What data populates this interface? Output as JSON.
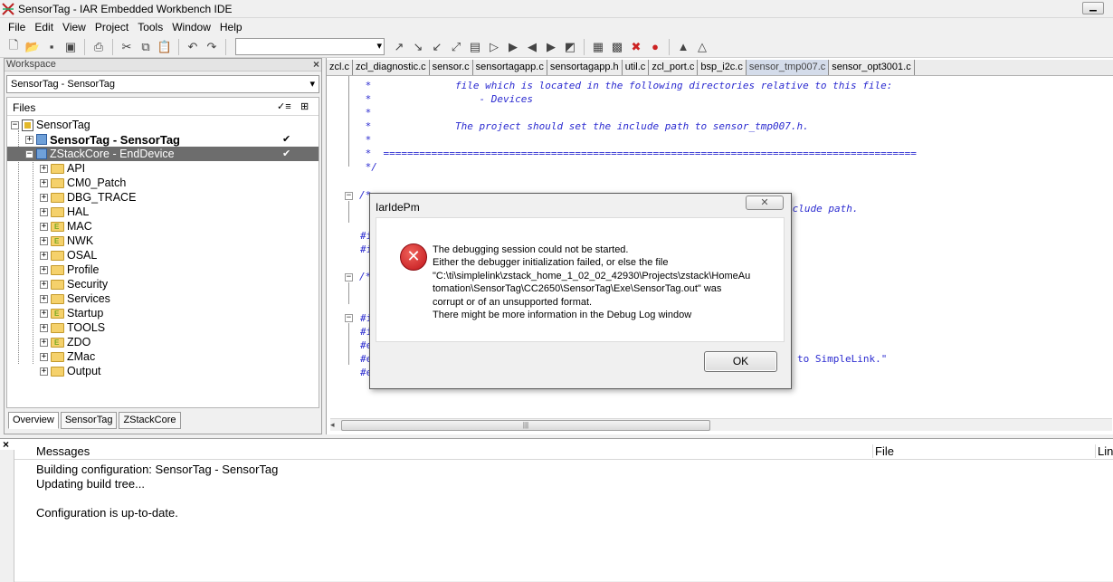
{
  "window": {
    "title": "SensorTag - IAR Embedded Workbench IDE"
  },
  "menu": [
    "File",
    "Edit",
    "View",
    "Project",
    "Tools",
    "Window",
    "Help"
  ],
  "workspace": {
    "header": "Workspace",
    "selected_config": "SensorTag - SensorTag",
    "files_header": "Files",
    "tree": {
      "root": "SensorTag",
      "project1": "SensorTag - SensorTag",
      "project2": "ZStackCore - EndDevice",
      "folders": [
        "API",
        "CM0_Patch",
        "DBG_TRACE",
        "HAL",
        "MAC",
        "NWK",
        "OSAL",
        "Profile",
        "Security",
        "Services",
        "Startup",
        "TOOLS",
        "ZDO",
        "ZMac",
        "Output"
      ]
    },
    "tabs": [
      "Overview",
      "SensorTag",
      "ZStackCore"
    ]
  },
  "editor": {
    "tabs": [
      "zcl.c",
      "zcl_diagnostic.c",
      "sensor.c",
      "sensortagapp.c",
      "sensortagapp.h",
      "util.c",
      "zcl_port.c",
      "bsp_i2c.c",
      "sensor_tmp007.c",
      "sensor_opt3001.c"
    ],
    "active_tab": "sensor_tmp007.c",
    "code": {
      "l1": " *              file which is located in the following directories relative to this file:",
      "l2": " *                  - Devices",
      "l3": " *",
      "l4": " *              The project should set the include path to sensor_tmp007.h.",
      "l5": " *",
      "l6": " *  =========================================================================================",
      "l7": " */",
      "l8": "/*",
      "l9": "nclude path.",
      "l10": "#i",
      "l11": "#i",
      "l12": "/*",
      "l13": "#i",
      "l14": "#i",
      "l15": "#e",
      "l16": "#e",
      "l17": "#e",
      "l18": "to SimpleLink.\""
    }
  },
  "messages": {
    "col_messages": "Messages",
    "col_file": "File",
    "col_line": "Lin",
    "lines": [
      "Building configuration: SensorTag - SensorTag",
      "Updating build tree...",
      "",
      "Configuration is up-to-date."
    ]
  },
  "dialog": {
    "title": "IarIdePm",
    "close": "✕",
    "icon": "error-icon",
    "lines": [
      "The debugging session could not be started.",
      "Either the debugger initialization failed, or else the file",
      "\"C:\\ti\\simplelink\\zstack_home_1_02_02_42930\\Projects\\zstack\\HomeAu",
      "tomation\\SensorTag\\CC2650\\SensorTag\\Exe\\SensorTag.out\" was",
      "corrupt or of an unsupported format.",
      "There might be more information in the Debug Log window"
    ],
    "ok": "OK"
  },
  "colors": {
    "code_comment": "#2b2bd0",
    "selected_row": "#6d6d6d",
    "error_red": "#c0141a"
  }
}
